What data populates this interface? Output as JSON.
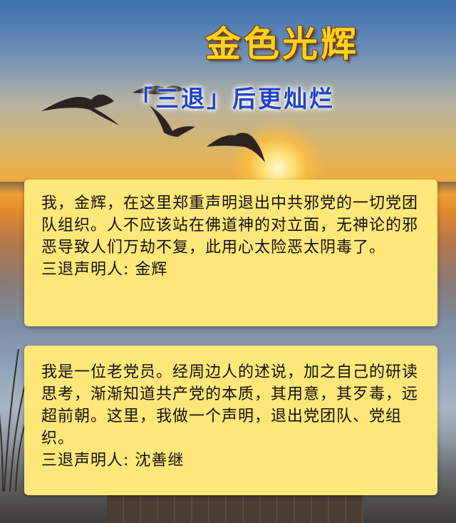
{
  "poster": {
    "title": "金色光辉",
    "subtitle": "「三退」后更灿烂"
  },
  "declarations": [
    {
      "text": "我，金辉，在这里郑重声明退出中共邪党的一切党团队组织。人不应该站在佛道神的对立面，无神论的邪恶导致人们万劫不复，此用心太险恶太阴毒了。",
      "signature": "三退声明人: 金辉"
    },
    {
      "text": "我是一位老党员。经周边人的述说，加之自己的研读思考，渐渐知道共产党的本质，其用意，其歹毒，远超前朝。这里，我做一个声明，退出党团队、党组织。",
      "signature": "三退声明人: 沈善继"
    }
  ],
  "colors": {
    "title": "#ffd21f",
    "subtitle": "#1f43c9",
    "card_background": "#ffe779"
  }
}
